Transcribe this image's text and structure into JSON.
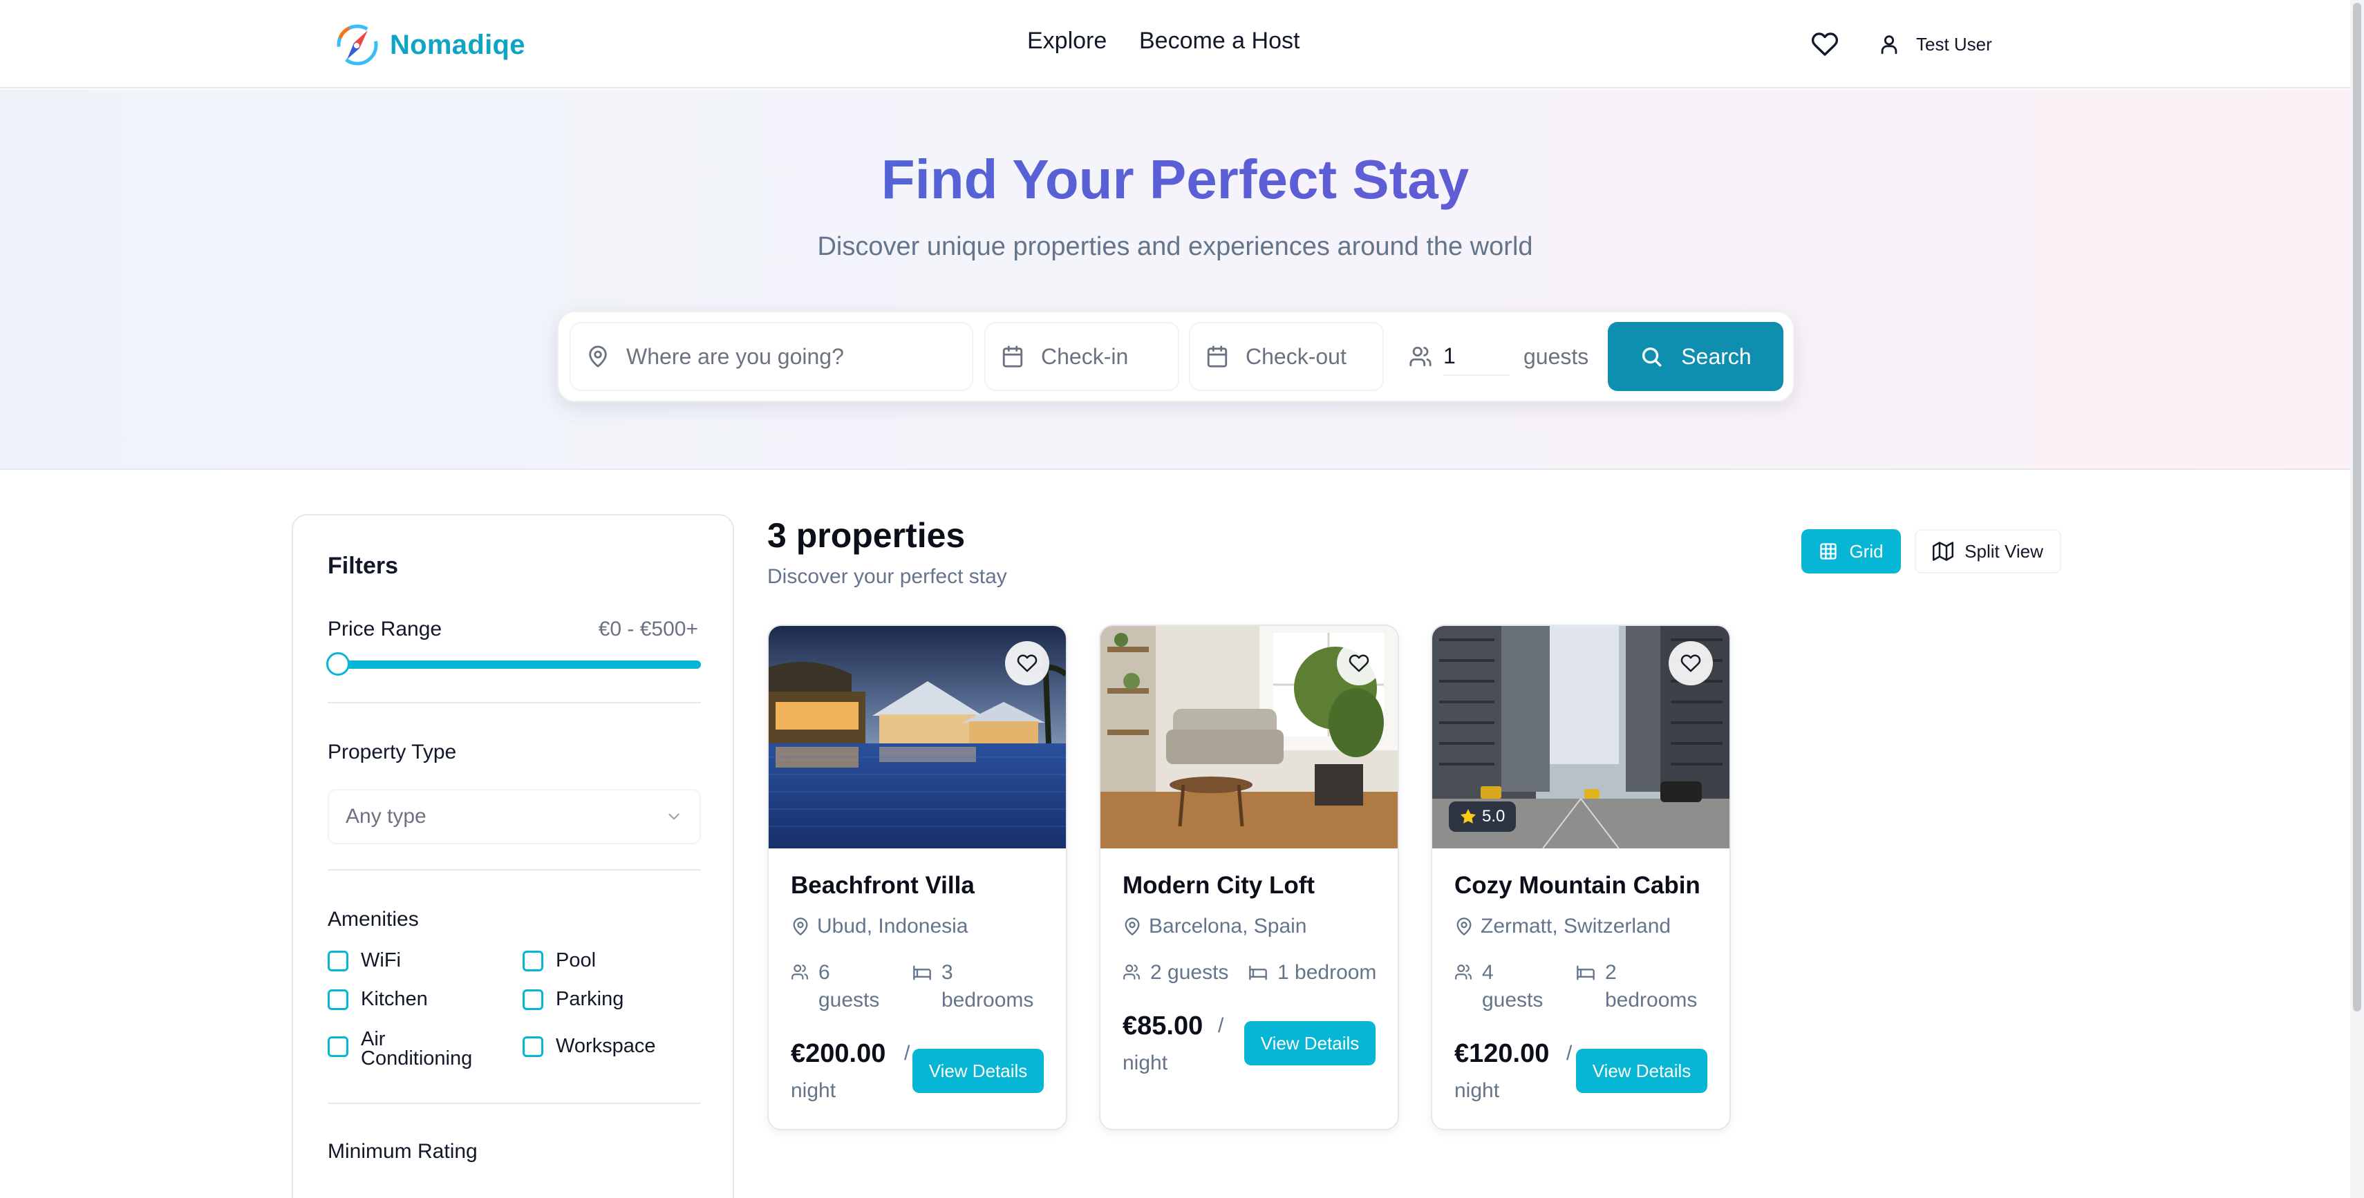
{
  "brand": {
    "name": "Nomadiqe"
  },
  "nav": {
    "links": [
      "Explore",
      "Become a Host"
    ],
    "user_name": "Test User"
  },
  "hero": {
    "title": "Find Your Perfect Stay",
    "subtitle": "Discover unique properties and experiences around the world"
  },
  "search": {
    "destination_placeholder": "Where are you going?",
    "checkin_placeholder": "Check-in",
    "checkout_placeholder": "Check-out",
    "guests_value": "1",
    "guests_label": "guests",
    "button_label": "Search"
  },
  "filters": {
    "title": "Filters",
    "price_label": "Price Range",
    "price_value": "€0 - €500+",
    "price_fill_fraction": 1.0,
    "property_type_label": "Property Type",
    "property_type_value": "Any type",
    "amenities_label": "Amenities",
    "amenities": [
      "WiFi",
      "Pool",
      "Kitchen",
      "Parking",
      "Air Conditioning",
      "Workspace"
    ],
    "min_rating_label": "Minimum Rating"
  },
  "results": {
    "count_label": "3 properties",
    "subtitle": "Discover your perfect stay",
    "view_grid": "Grid",
    "view_split": "Split View"
  },
  "properties": [
    {
      "title": "Beachfront Villa",
      "location": "Ubud, Indonesia",
      "guests": "6 guests",
      "bedrooms": "3 bedrooms",
      "price": "€200.00",
      "per": "night",
      "rating": "",
      "button": "View Details"
    },
    {
      "title": "Modern City Loft",
      "location": "Barcelona, Spain",
      "guests": "2 guests",
      "bedrooms": "1 bedroom",
      "price": "€85.00",
      "per": "night",
      "rating": "",
      "button": "View Details"
    },
    {
      "title": "Cozy Mountain Cabin",
      "location": "Zermatt, Switzerland",
      "guests": "4 guests",
      "bedrooms": "2 bedrooms",
      "price": "€120.00",
      "per": "night",
      "rating": "5.0",
      "button": "View Details"
    }
  ],
  "colors": {
    "accent": "#06b6d4",
    "search_button": "#0e8fb0",
    "title_gradient_start": "#3d6fd6",
    "title_gradient_end": "#6b55cf"
  }
}
